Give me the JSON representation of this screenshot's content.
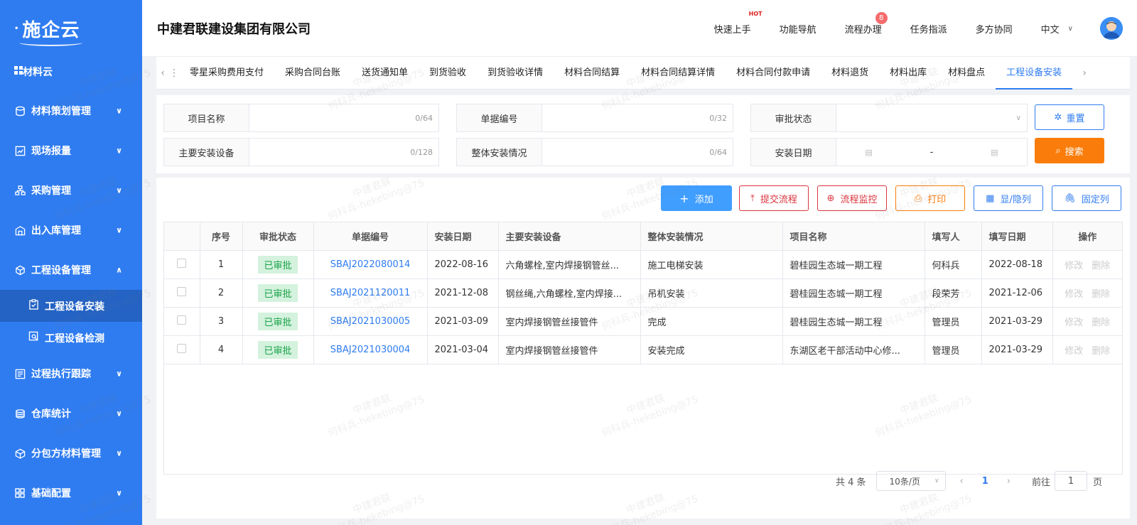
{
  "app": {
    "logo": "施企云",
    "company": "中建君联建设集团有限公司"
  },
  "header": {
    "nav": [
      "快速上手",
      "功能导航",
      "流程办理",
      "任务指派",
      "多方协同"
    ],
    "hot_label": "HOT",
    "flow_badge": "8",
    "language": "中文"
  },
  "sidebar": {
    "root": "材料云",
    "items": [
      {
        "label": "材料策划管理",
        "icon": "database-icon"
      },
      {
        "label": "现场报量",
        "icon": "report-icon"
      },
      {
        "label": "采购管理",
        "icon": "org-icon"
      },
      {
        "label": "出入库管理",
        "icon": "warehouse-icon"
      },
      {
        "label": "工程设备管理",
        "icon": "cube-icon"
      },
      {
        "label": "过程执行跟踪",
        "icon": "track-icon"
      },
      {
        "label": "仓库统计",
        "icon": "stack-icon"
      },
      {
        "label": "分包方材料管理",
        "icon": "package-icon"
      },
      {
        "label": "基础配置",
        "icon": "grid-icon"
      }
    ],
    "sub_items": [
      "工程设备安装",
      "工程设备检测"
    ]
  },
  "tabs": [
    "零星采购费用支付",
    "采购合同台账",
    "送货通知单",
    "到货验收",
    "到货验收详情",
    "材料合同结算",
    "材料合同结算详情",
    "材料合同付款申请",
    "材料退货",
    "材料出库",
    "材料盘点",
    "工程设备安装"
  ],
  "filter": {
    "project_name_label": "项目名称",
    "project_name_count": "0/64",
    "doc_no_label": "单据编号",
    "doc_no_count": "0/32",
    "approval_label": "审批状态",
    "main_equip_label": "主要安装设备",
    "main_equip_count": "0/128",
    "overall_label": "整体安装情况",
    "overall_count": "0/64",
    "date_label": "安装日期",
    "date_sep": "-",
    "reset": "重置",
    "search": "搜索"
  },
  "toolbar": {
    "add": "添加",
    "submit": "提交流程",
    "monitor": "流程监控",
    "print": "打印",
    "columns": "显/隐列",
    "fix": "固定列"
  },
  "table": {
    "headers": [
      "序号",
      "审批状态",
      "单据编号",
      "安装日期",
      "主要安装设备",
      "整体安装情况",
      "项目名称",
      "填写人",
      "填写日期",
      "操作"
    ],
    "rows": [
      {
        "no": "1",
        "status": "已审批",
        "doc": "SBAJ2022080014",
        "date": "2022-08-16",
        "equip": "六角螺栓,室内焊接钢管丝...",
        "overall": "施工电梯安装",
        "project": "碧桂园生态城一期工程",
        "user": "何科兵",
        "fill_date": "2022-08-18"
      },
      {
        "no": "2",
        "status": "已审批",
        "doc": "SBAJ2021120011",
        "date": "2021-12-08",
        "equip": "钢丝绳,六角螺栓,室内焊接...",
        "overall": "吊机安装",
        "project": "碧桂园生态城一期工程",
        "user": "段荣芳",
        "fill_date": "2021-12-06"
      },
      {
        "no": "3",
        "status": "已审批",
        "doc": "SBAJ2021030005",
        "date": "2021-03-09",
        "equip": "室内焊接钢管丝接管件",
        "overall": "完成",
        "project": "碧桂园生态城一期工程",
        "user": "管理员",
        "fill_date": "2021-03-29"
      },
      {
        "no": "4",
        "status": "已审批",
        "doc": "SBAJ2021030004",
        "date": "2021-03-04",
        "equip": "室内焊接钢管丝接管件",
        "overall": "安装完成",
        "project": "东湖区老干部活动中心修...",
        "user": "管理员",
        "fill_date": "2021-03-29"
      }
    ],
    "edit": "修改",
    "delete": "删除"
  },
  "pager": {
    "total": "共 4 条",
    "page_size": "10条/页",
    "current": "1",
    "goto_label": "前往",
    "goto_value": "1",
    "page_unit": "页"
  },
  "watermark": {
    "line1": "中建君联",
    "line2": "何科兵-hekebing@75"
  }
}
